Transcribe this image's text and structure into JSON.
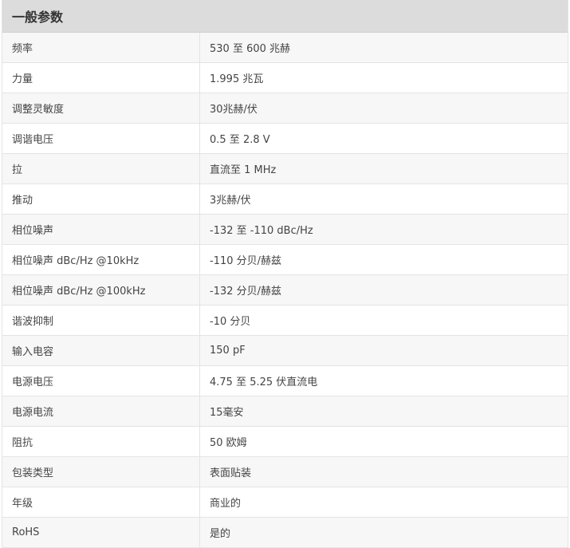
{
  "section": {
    "title": "一般参数"
  },
  "rows": [
    {
      "name": "频率",
      "value": "530 至 600 兆赫"
    },
    {
      "name": "力量",
      "value": "1.995 兆瓦"
    },
    {
      "name": "调整灵敏度",
      "value": "30兆赫/伏"
    },
    {
      "name": "调谐电压",
      "value": "0.5 至 2.8 V"
    },
    {
      "name": "拉",
      "value": "直流至 1 MHz"
    },
    {
      "name": "推动",
      "value": "3兆赫/伏"
    },
    {
      "name": "相位噪声",
      "value": "-132 至 -110 dBc/Hz"
    },
    {
      "name": "相位噪声 dBc/Hz @10kHz",
      "value": "-110 分贝/赫兹"
    },
    {
      "name": "相位噪声 dBc/Hz @100kHz",
      "value": "-132 分贝/赫兹"
    },
    {
      "name": "谐波抑制",
      "value": "-10 分贝"
    },
    {
      "name": "输入电容",
      "value": "150 pF"
    },
    {
      "name": "电源电压",
      "value": "4.75 至 5.25 伏直流电"
    },
    {
      "name": "电源电流",
      "value": "15毫安"
    },
    {
      "name": "阻抗",
      "value": "50 欧姆"
    },
    {
      "name": "包装类型",
      "value": "表面贴装"
    },
    {
      "name": "年级",
      "value": "商业的"
    },
    {
      "name": "RoHS",
      "value": "是的"
    }
  ]
}
